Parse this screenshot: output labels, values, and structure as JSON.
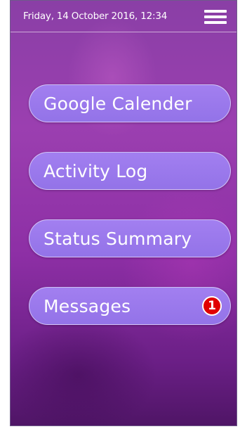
{
  "status_bar": {
    "datetime": "Friday, 14 October 2016, 12:34",
    "menu_icon": "hamburger-menu-icon"
  },
  "menu": {
    "items": [
      {
        "label": "Google Calender"
      },
      {
        "label": "Activity Log"
      },
      {
        "label": "Status Summary"
      },
      {
        "label": "Messages",
        "badge": "1"
      }
    ]
  },
  "colors": {
    "background_top": "#8a3fa6",
    "background_bottom": "#4f1566",
    "button_fill": "#9b78ec",
    "badge_red": "#e00000",
    "text": "#ffffff"
  }
}
